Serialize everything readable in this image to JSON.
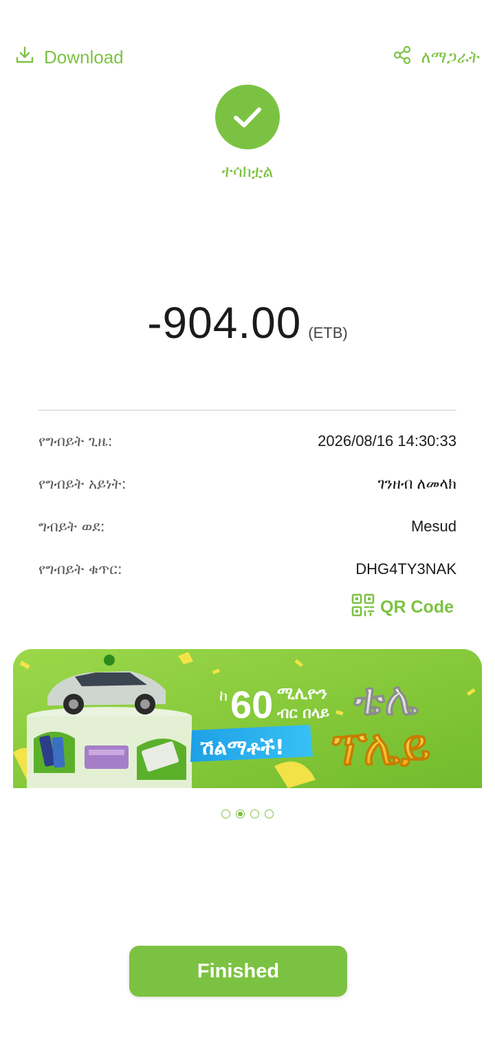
{
  "header": {
    "download_label": "Download",
    "download_icon": "download-icon",
    "share_label": "ለማጋራት",
    "share_icon": "share-icon"
  },
  "status": {
    "icon": "checkmark-icon",
    "label": "ተሳክቷል"
  },
  "amount": {
    "value": "-904.00",
    "currency": "(ETB)"
  },
  "details": [
    {
      "label": "የግብይት ጊዜ:",
      "value": "2026/08/16 14:30:33"
    },
    {
      "label": "የግብይት አይነት:",
      "value": "ገንዘብ ለመላክ"
    },
    {
      "label": "ግብይት ወደ:",
      "value": "Mesud"
    },
    {
      "label": "የግብይት ቁጥር:",
      "value": "DHG4TY3NAK"
    }
  ],
  "qr": {
    "label": "QR Code",
    "icon": "qr-code-icon"
  },
  "banner": {
    "prefix": "ከ",
    "amount": "60",
    "line1": "ሚሊዮን",
    "line2": "ብር በላይ",
    "badge": "ሽልማቶች!",
    "title_top": "ቴሌ",
    "title_bottom": "ፕሌይ"
  },
  "carousel": {
    "total": 4,
    "active_index": 1
  },
  "footer": {
    "finished_label": "Finished"
  },
  "colors": {
    "accent": "#7cc242",
    "text": "#1b1b1b",
    "muted": "#5a5a5a"
  }
}
